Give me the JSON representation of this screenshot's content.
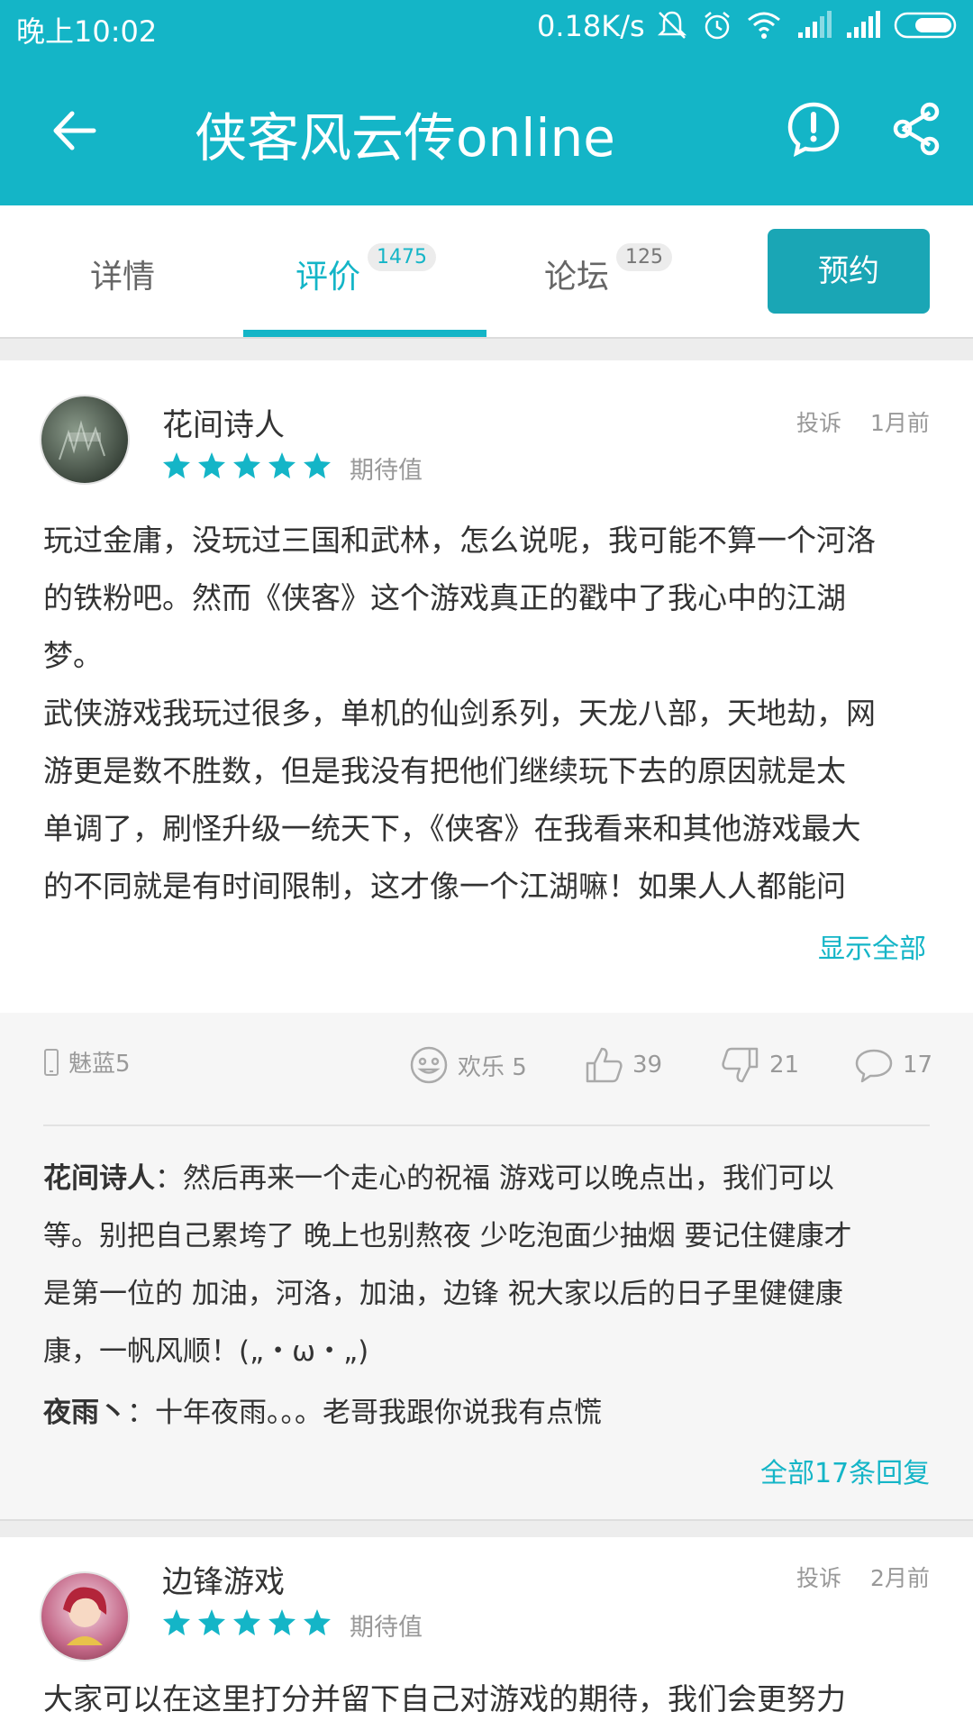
{
  "status_bar": {
    "time": "晚上10:02",
    "net_speed": "0.18K/s",
    "icons": [
      "mute-icon",
      "alarm-icon",
      "wifi-icon",
      "signal-icon",
      "signal-icon",
      "battery-icon"
    ]
  },
  "app_bar": {
    "title": "侠客风云传online",
    "back_icon": "back-arrow-icon",
    "report_icon": "report-icon",
    "share_icon": "share-icon"
  },
  "tabs": {
    "items": [
      {
        "label": "详情",
        "badge": ""
      },
      {
        "label": "评价",
        "badge": "1475"
      },
      {
        "label": "论坛",
        "badge": "125"
      }
    ],
    "active_index": 1,
    "reserve_button": "预约"
  },
  "reviews": [
    {
      "user": "花间诗人",
      "rating": 5,
      "rating_label": "期待值",
      "complain": "投诉",
      "time_ago": "1月前",
      "text_lines": [
        "玩过金庸，没玩过三国和武林，怎么说呢，我可能不算一个河洛",
        "的铁粉吧。然而《侠客》这个游戏真正的戳中了我心中的江湖",
        "梦。",
        "武侠游戏我玩过很多，单机的仙剑系列，天龙八部，天地劫，网",
        "游更是数不胜数，但是我没有把他们继续玩下去的原因就是太",
        "单调了，刷怪升级一统天下，《侠客》在我看来和其他游戏最大",
        "的不同就是有时间限制，这才像一个江湖嘛！如果人人都能问"
      ],
      "show_all": "显示全部",
      "device": "魅蓝5",
      "fun": "欢乐 5",
      "likes": "39",
      "dislikes": "21",
      "comments": "17",
      "replies": [
        {
          "author": "花间诗人",
          "sep": "：",
          "lines": [
            "然后再来一个走心的祝福 游戏可以晚点出，我们可以",
            "等。别把自己累垮了 晚上也别熬夜 少吃泡面少抽烟 要记住健康才",
            "是第一位的 加油，河洛，加油，边锋 祝大家以后的日子里健健康",
            "康，一帆风顺！(„・ω・„)"
          ]
        },
        {
          "author": "夜雨丶",
          "sep": "：",
          "lines": [
            "十年夜雨。。。老哥我跟你说我有点慌"
          ]
        }
      ],
      "all_replies": "全部17条回复"
    },
    {
      "user": "边锋游戏",
      "rating": 5,
      "rating_label": "期待值",
      "complain": "投诉",
      "time_ago": "2月前",
      "text_lines": [
        "大家可以在这里打分并留下自己对游戏的期待，我们会更努力"
      ]
    }
  ],
  "colors": {
    "accent": "#14b5c7",
    "reserve_bg": "#1aa6b5",
    "gray_text": "#999999"
  }
}
